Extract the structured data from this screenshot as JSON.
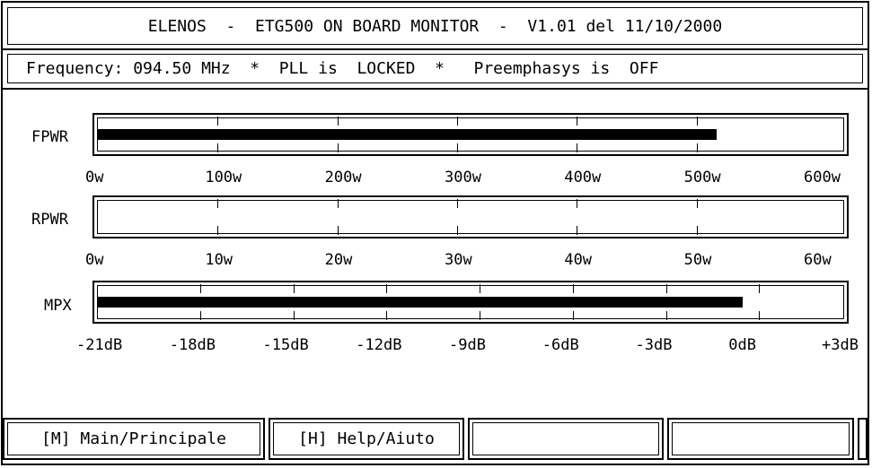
{
  "header": {
    "title": "ELENOS  -  ETG500 ON BOARD MONITOR  -  V1.01 del 11/10/2000"
  },
  "status": {
    "text": "Frequency: 094.50 MHz  *  PLL is  LOCKED  *   Preemphasys is  OFF"
  },
  "meters": {
    "fpwr": {
      "label": "FPWR",
      "level": 0.83,
      "scale": [
        "0w",
        "100w",
        "200w",
        "300w",
        "400w",
        "500w",
        "600w"
      ]
    },
    "rpwr": {
      "label": "RPWR",
      "level": 0.0,
      "scale": [
        "0w",
        "10w",
        "20w",
        "30w",
        "40w",
        "50w",
        "60w"
      ]
    },
    "mpx": {
      "label": "MPX",
      "level": 0.865,
      "scale": [
        "-21dB",
        "-18dB",
        "-15dB",
        "-12dB",
        "-9dB",
        "-6dB",
        "-3dB",
        "0dB",
        "+3dB"
      ]
    }
  },
  "menu": {
    "main": "[M] Main/Principale",
    "help": "[H] Help/Aiuto",
    "empty1": "",
    "empty2": "",
    "empty3": ""
  }
}
